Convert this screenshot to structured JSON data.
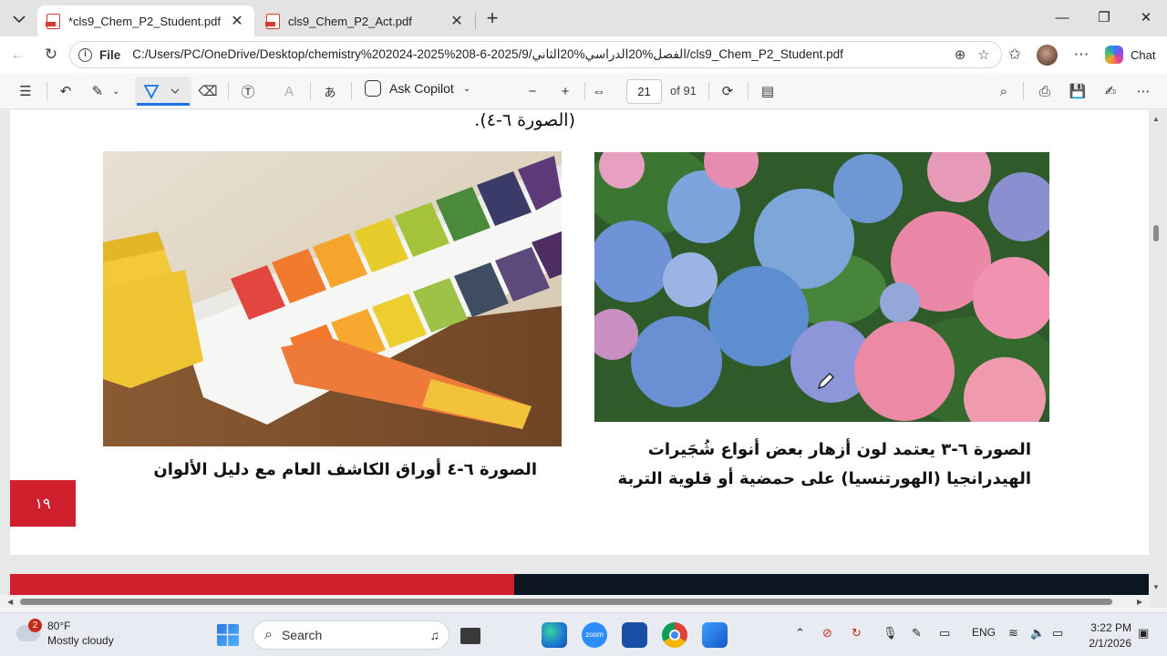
{
  "tabs": [
    {
      "title": "*cls9_Chem_P2_Student.pdf",
      "active": true
    },
    {
      "title": "cls9_Chem_P2_Act.pdf",
      "active": false
    }
  ],
  "address": {
    "scheme_label": "File",
    "url": "C:/Users/PC/OneDrive/Desktop/chemistry%202024-2025%208-6-2025/9/الفصل%20الدراسي%20الثاني/cls9_Chem_P2_Student.pdf"
  },
  "chat_label": "Chat",
  "toolbar": {
    "ask_copilot": "Ask Copilot",
    "current_page": "21",
    "page_of": "of 91"
  },
  "document": {
    "top_line": "(الصورة ٦-٤).",
    "caption_flowers_line1": "الصورة ٦-٣ يعتمد لون أزهار بعض أنواع شُجَيرات",
    "caption_flowers_line2": "الهيدرانجيا (الهورتنسيا) على حمضية أو قلوية التربة",
    "caption_ph": "الصورة ٦-٤ أوراق الكاشف العام مع دليل الألوان",
    "page_number": "١٩"
  },
  "taskbar": {
    "weather_temp": "80°F",
    "weather_desc": "Mostly cloudy",
    "weather_badge": "2",
    "search_placeholder": "Search",
    "language": "ENG",
    "time": "3:22 PM",
    "date": "2/1/2026"
  },
  "colors": {
    "accent_red": "#d0202e",
    "band_dark": "#0c1522",
    "focus_blue": "#1a73e8"
  },
  "icons": [
    "tab-menu-icon",
    "pdf-file-icon",
    "close-icon",
    "plus-icon",
    "minimize-icon",
    "restore-icon",
    "back-icon",
    "refresh-icon",
    "info-icon",
    "zoom-icon",
    "star-icon",
    "favorites-icon",
    "more-icon",
    "copilot-icon",
    "contents-icon",
    "undo-icon",
    "highlight-icon",
    "draw-icon",
    "eraser-icon",
    "text-box-icon",
    "read-aloud-icon",
    "translate-icon",
    "minus-icon",
    "fit-width-icon",
    "rotate-icon",
    "page-view-icon",
    "search-icon",
    "print-icon",
    "save-icon",
    "save-as-icon",
    "pencil-cursor-icon",
    "windows-start-icon",
    "edge-icon",
    "zoom-app-icon",
    "mail-icon",
    "chrome-icon",
    "store-icon",
    "chevron-up-icon",
    "mic-icon",
    "wifi-icon",
    "volume-icon",
    "battery-icon",
    "notification-icon"
  ]
}
